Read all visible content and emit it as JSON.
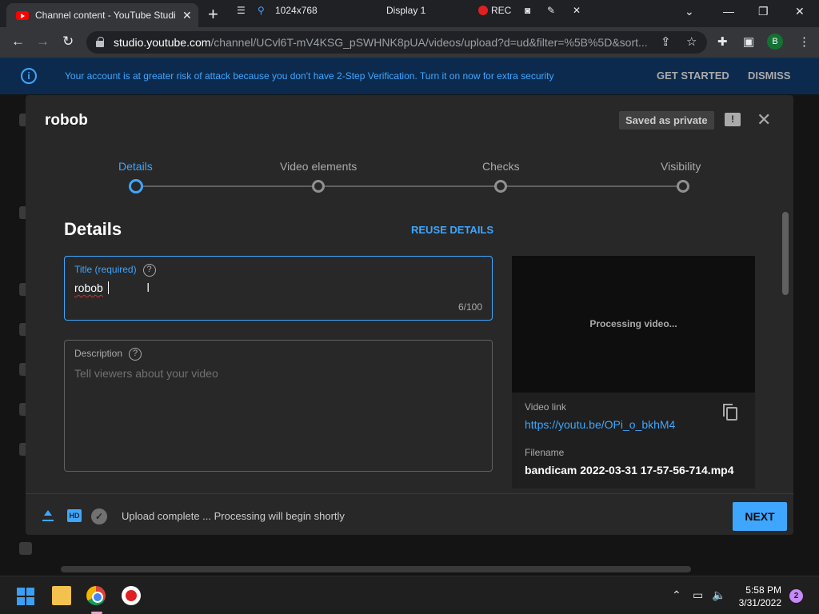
{
  "browser": {
    "tab_title": "Channel content - YouTube Studio",
    "tab_close": "✕",
    "new_tab": "+",
    "recorder": {
      "resolution": "1024x768",
      "display": "Display 1",
      "rec": "REC"
    },
    "url_host": "studio.youtube.com",
    "url_path": "/channel/UCvl6T-mV4KSG_pSWHNK8pUA/videos/upload?d=ud&filter=%5B%5D&sort...",
    "profile_initial": "B"
  },
  "banner": {
    "message": "Your account is at greater risk of attack because you don't have 2-Step Verification. Turn it on now for extra security",
    "get_started": "GET STARTED",
    "dismiss": "DISMISS"
  },
  "dialog": {
    "title": "robob",
    "saved_badge": "Saved as private",
    "steps": [
      {
        "label": "Details",
        "active": true
      },
      {
        "label": "Video elements",
        "active": false
      },
      {
        "label": "Checks",
        "active": false
      },
      {
        "label": "Visibility",
        "active": false
      }
    ],
    "section_heading": "Details",
    "reuse_details": "REUSE DETAILS",
    "title_field": {
      "label": "Title (required)",
      "value": "robob",
      "count": "6/100"
    },
    "description_field": {
      "label": "Description",
      "placeholder": "Tell viewers about your video"
    },
    "preview": {
      "processing": "Processing video...",
      "video_link_label": "Video link",
      "video_link": "https://youtu.be/OPi_o_bkhM4",
      "filename_label": "Filename",
      "filename": "bandicam 2022-03-31 17-57-56-714.mp4"
    },
    "footer": {
      "status": "Upload complete ... Processing will begin shortly",
      "next": "NEXT"
    }
  },
  "taskbar": {
    "time": "5:58 PM",
    "date": "3/31/2022",
    "notifications": "2"
  },
  "colors": {
    "accent": "#3ea6ff",
    "dialog_bg": "#282828",
    "banner_bg": "#0c2a4d"
  }
}
